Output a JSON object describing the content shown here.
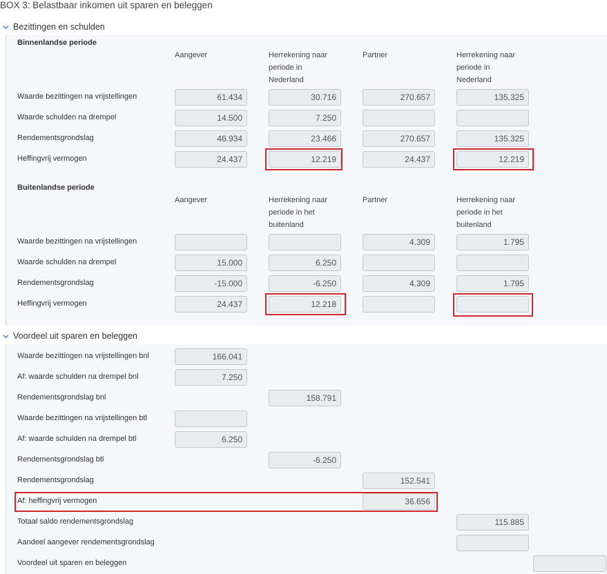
{
  "page": {
    "title": "BOX 3: Belastbaar inkomen uit sparen en beleggen"
  },
  "sections": {
    "bezittingen": {
      "title": "Bezittingen en schulden"
    },
    "voordeel": {
      "title": "Voordeel uit sparen en beleggen"
    }
  },
  "binnen": {
    "title": "Binnenlandse periode",
    "headers": [
      [
        "Aangever"
      ],
      [
        "Herrekening naar",
        "periode in",
        "Nederland"
      ],
      [
        "Partner"
      ],
      [
        "Herrekening naar",
        "periode in",
        "Nederland"
      ]
    ],
    "rows": [
      {
        "label": "Waarde bezittingen na vrijstellingen",
        "values": [
          "61.434",
          "30.716",
          "270.657",
          "135.325"
        ]
      },
      {
        "label": "Waarde schulden na drempel",
        "values": [
          "14.500",
          "7.250",
          "",
          ""
        ]
      },
      {
        "label": "Rendementsgrondslag",
        "values": [
          "46.934",
          "23.466",
          "270.657",
          "135.325"
        ]
      },
      {
        "label": "Heffingvrij vermogen",
        "values": [
          "24.437",
          "12.219",
          "24.437",
          "12.219"
        ]
      }
    ]
  },
  "buiten": {
    "title": "Buitenlandse periode",
    "headers": [
      [
        "Aangever"
      ],
      [
        "Herrekening naar",
        "periode in het",
        "buitenland"
      ],
      [
        "Partner"
      ],
      [
        "Herrekening naar",
        "periode in het",
        "buitenland"
      ]
    ],
    "rows": [
      {
        "label": "Waarde bezittingen na vrijstellingen",
        "values": [
          "",
          "",
          "4.309",
          "1.795"
        ]
      },
      {
        "label": "Waarde schulden na drempel",
        "values": [
          "15.000",
          "6.250",
          "",
          ""
        ]
      },
      {
        "label": "Rendementsgrondslag",
        "values": [
          "-15.000",
          "-6.250",
          "4.309",
          "1.795"
        ]
      },
      {
        "label": "Heffingvrij vermogen",
        "values": [
          "24.437",
          "12.218",
          "",
          ""
        ]
      }
    ]
  },
  "voordeel": {
    "rows": [
      {
        "label": "Waarde bezittingen na vrijstellingen bnl",
        "value": "166.041"
      },
      {
        "label": "Af: waarde schulden na drempel bnl",
        "value": "7.250"
      },
      {
        "label": "Rendementsgrondslag bnl",
        "value": "158.791"
      },
      {
        "label": "Waarde bezittingen na vrijstellingen btl",
        "value": ""
      },
      {
        "label": "Af: waarde schulden na drempel btl",
        "value": "6.250"
      },
      {
        "label": "Rendementsgrondslag btl",
        "value": "-6.250"
      },
      {
        "label": "Rendementsgrondslag",
        "value": "152.541"
      },
      {
        "label": "Af: heffingvrij vermogen",
        "value": "36.656"
      },
      {
        "label": "Totaal saldo rendementsgrondslag",
        "value": "115.885"
      },
      {
        "label": "Aandeel aangever rendementsgrondslag",
        "value": ""
      },
      {
        "label": "Voordeel uit sparen en beleggen",
        "value": ""
      }
    ]
  },
  "colors": {
    "highlight": "#d0262e",
    "chevron": "#5b8fc7",
    "field_bg": "#e9ecef",
    "panel_bg": "#f5f7fa"
  },
  "icons": {
    "collapse": "chevron-down-icon"
  }
}
